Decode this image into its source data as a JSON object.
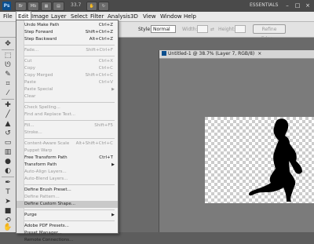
{
  "app_bar": {
    "logo": "Ps",
    "buttons": [
      "Br",
      "Mb"
    ],
    "zoom": "33.7",
    "workspace": "ESSENTIALS",
    "window_controls": [
      "–",
      "□",
      "×"
    ]
  },
  "menubar": {
    "items": [
      "File",
      "Edit",
      "Image",
      "Layer",
      "Select",
      "Filter",
      "Analysis",
      "3D",
      "View",
      "Window",
      "Help"
    ],
    "active": "Edit"
  },
  "options": {
    "style_label": "Style:",
    "style_value": "Normal",
    "width_label": "Width:",
    "height_label": "Height:",
    "refine_button": "Refine Edge..."
  },
  "edit_menu": [
    {
      "label": "Undo Make Path",
      "shortcut": "Ctrl+Z"
    },
    {
      "label": "Step Forward",
      "shortcut": "Shift+Ctrl+Z"
    },
    {
      "label": "Step Backward",
      "shortcut": "Alt+Ctrl+Z"
    },
    {
      "sep": true
    },
    {
      "label": "Fade...",
      "shortcut": "Shift+Ctrl+F",
      "dim": true
    },
    {
      "sep": true
    },
    {
      "label": "Cut",
      "shortcut": "Ctrl+X",
      "dim": true
    },
    {
      "label": "Copy",
      "shortcut": "Ctrl+C",
      "dim": true
    },
    {
      "label": "Copy Merged",
      "shortcut": "Shift+Ctrl+C",
      "dim": true
    },
    {
      "label": "Paste",
      "shortcut": "Ctrl+V",
      "dim": true
    },
    {
      "label": "Paste Special",
      "arrow": true,
      "dim": true
    },
    {
      "label": "Clear",
      "dim": true
    },
    {
      "sep": true
    },
    {
      "label": "Check Spelling...",
      "dim": true
    },
    {
      "label": "Find and Replace Text...",
      "dim": true
    },
    {
      "sep": true
    },
    {
      "label": "Fill...",
      "shortcut": "Shift+F5",
      "dim": true
    },
    {
      "label": "Stroke...",
      "dim": true
    },
    {
      "sep": true
    },
    {
      "label": "Content-Aware Scale",
      "shortcut": "Alt+Shift+Ctrl+C",
      "dim": true
    },
    {
      "label": "Puppet Warp",
      "dim": true
    },
    {
      "label": "Free Transform Path",
      "shortcut": "Ctrl+T"
    },
    {
      "label": "Transform Path",
      "arrow": true
    },
    {
      "label": "Auto-Align Layers...",
      "dim": true
    },
    {
      "label": "Auto-Blend Layers...",
      "dim": true
    },
    {
      "sep": true
    },
    {
      "label": "Define Brush Preset..."
    },
    {
      "label": "Define Pattern...",
      "dim": true
    },
    {
      "label": "Define Custom Shape...",
      "highlight": true
    },
    {
      "sep": true
    },
    {
      "label": "Purge",
      "arrow": true
    },
    {
      "sep": true
    },
    {
      "label": "Adobe PDF Presets..."
    },
    {
      "label": "Preset Manager..."
    },
    {
      "label": "Remote Connections..."
    }
  ],
  "document": {
    "title": "Untitled-1 @ 38.7% (Layer 7, RGB/8)",
    "close": "×"
  },
  "toolbar_icons": [
    "move-icon",
    "marquee-icon",
    "lasso-icon",
    "quick-select-icon",
    "crop-icon",
    "eyedropper-icon",
    "healing-icon",
    "brush-icon",
    "stamp-icon",
    "history-brush-icon",
    "eraser-icon",
    "gradient-icon",
    "blur-icon",
    "dodge-icon",
    "pen-icon",
    "type-icon",
    "path-select-icon",
    "shape-icon",
    "3d-rotate-icon",
    "3d-orbit-icon",
    "hand-icon",
    "zoom-icon"
  ]
}
